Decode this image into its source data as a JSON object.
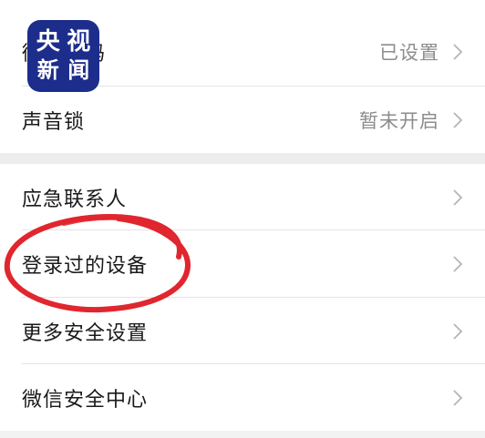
{
  "section1": {
    "items": [
      {
        "label": "微信密码",
        "value": "已设置"
      },
      {
        "label": "声音锁",
        "value": "暂未开启"
      }
    ]
  },
  "section2": {
    "items": [
      {
        "label": "应急联系人"
      },
      {
        "label": "登录过的设备"
      },
      {
        "label": "更多安全设置"
      },
      {
        "label": "微信安全中心"
      }
    ]
  },
  "watermark": {
    "text": "央视新闻",
    "bg_color": "#1c2d8c"
  },
  "annotation": {
    "color": "#e0262e",
    "target": "登录过的设备"
  },
  "icons": {
    "chevron": "chevron-right-icon"
  }
}
